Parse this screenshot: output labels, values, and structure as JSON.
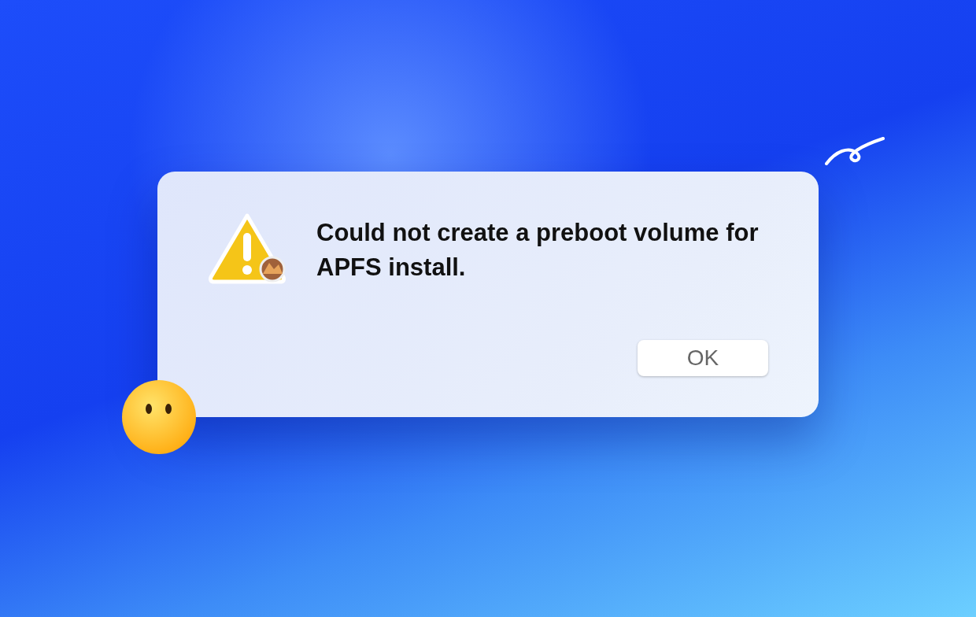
{
  "dialog": {
    "message": "Could not create a preboot volume for APFS install.",
    "buttons": [
      "OK"
    ]
  }
}
